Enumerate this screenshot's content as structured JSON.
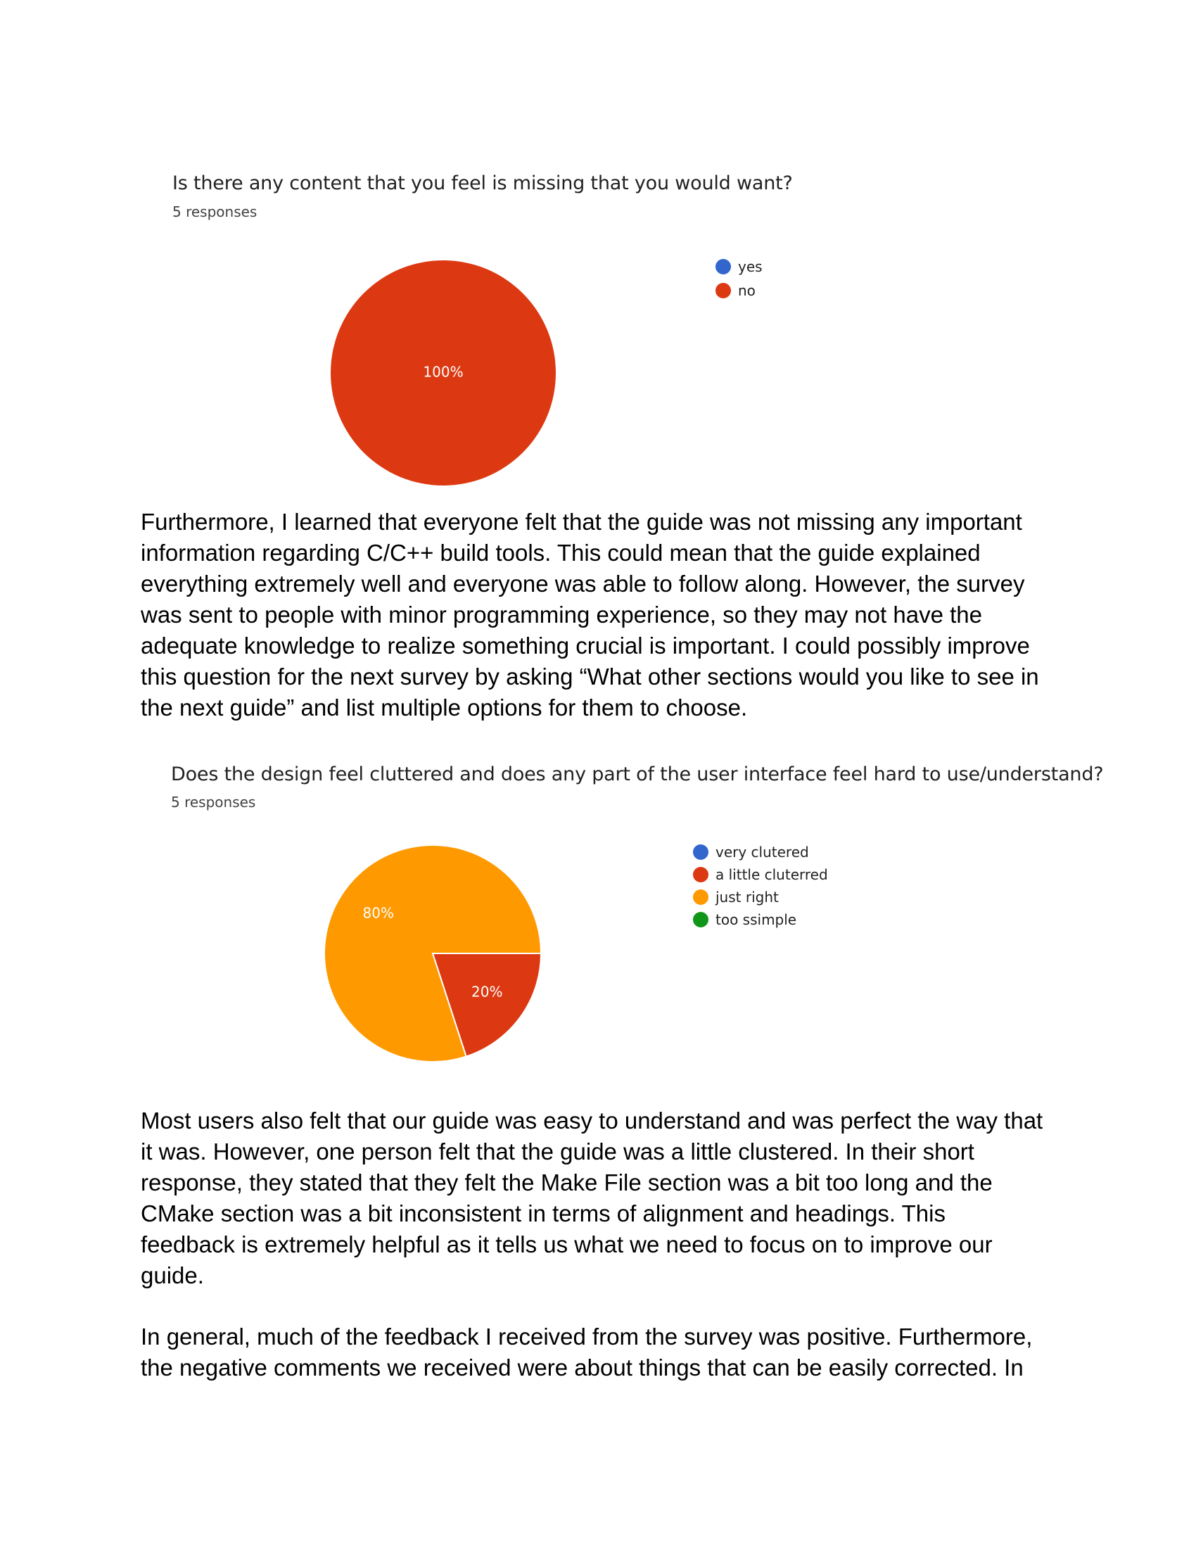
{
  "charts": [
    {
      "question": "Is there any content that you feel is missing that you would want?",
      "responses": "5 responses",
      "legend": [
        {
          "label": "yes",
          "color": "#3366cc"
        },
        {
          "label": "no",
          "color": "#dc3912"
        }
      ]
    },
    {
      "question": "Does the design feel cluttered and does any part of the user interface feel hard to use/understand?",
      "responses": "5 responses",
      "legend": [
        {
          "label": "very clutered",
          "color": "#3366cc"
        },
        {
          "label": "a little cluterred",
          "color": "#dc3912"
        },
        {
          "label": "just right",
          "color": "#ff9900"
        },
        {
          "label": "too ssimple",
          "color": "#109618"
        }
      ]
    }
  ],
  "chart_data": [
    {
      "type": "pie",
      "title": "Is there any content that you feel is missing that you would want?",
      "categories": [
        "yes",
        "no"
      ],
      "values": [
        0,
        100
      ],
      "slice_labels": [
        "",
        "100%"
      ],
      "colors": [
        "#3366cc",
        "#dc3912"
      ],
      "legend_position": "right"
    },
    {
      "type": "pie",
      "title": "Does the design feel cluttered and does any part of the user interface feel hard to use/understand?",
      "categories": [
        "very clutered",
        "a little cluterred",
        "just right",
        "too ssimple"
      ],
      "values": [
        0,
        20,
        80,
        0
      ],
      "slice_labels": [
        "",
        "20%",
        "80%",
        ""
      ],
      "colors": [
        "#3366cc",
        "#dc3912",
        "#ff9900",
        "#109618"
      ],
      "legend_position": "right"
    }
  ],
  "paragraphs": [
    [
      "Furthermore, I learned that everyone felt that the guide was not missing any important",
      "information regarding C/C++ build tools. This could mean that the guide explained",
      "everything extremely well and everyone was able to follow along. However, the survey",
      "was sent to people with minor programming experience, so they may not have the",
      "adequate knowledge to realize something crucial is important. I could possibly improve",
      "this question for the next survey by asking “What other sections would you like to see in",
      "the next guide” and list multiple options for them to choose."
    ],
    [
      "Most users also felt that our guide was easy to understand and was perfect the way that",
      "it was. However, one person felt that the guide was a little clustered. In their short",
      "response, they stated that they felt the Make File section was a bit too long and the",
      "CMake section was a bit inconsistent in terms of alignment and headings. This",
      "feedback is extremely helpful as it tells us what we need to focus on to improve our",
      "guide."
    ],
    [
      "In general, much of the feedback I received from the survey was positive. Furthermore,",
      "the negative comments we received were about things that can be easily corrected. In"
    ]
  ]
}
